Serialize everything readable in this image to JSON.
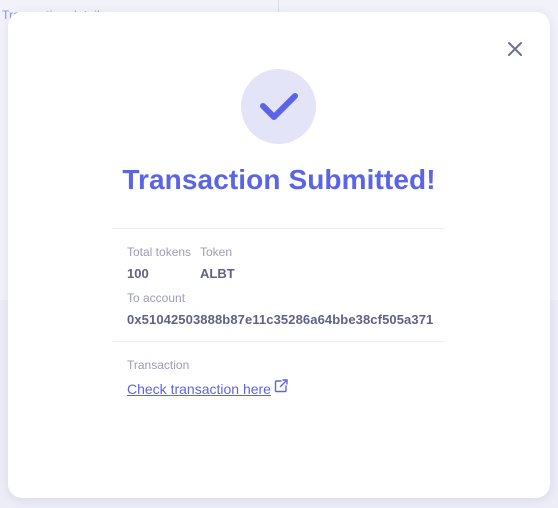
{
  "background": {
    "text": "Transaction details"
  },
  "modal": {
    "title": "Transaction Submitted!",
    "close_icon": "close-icon",
    "status_icon": "checkmark-icon",
    "details": {
      "total_tokens_label": "Total tokens",
      "total_tokens_value": "100",
      "token_label": "Token",
      "token_value": "ALBT",
      "to_account_label": "To account",
      "to_account_value": "0x51042503888b87e11c35286a64bbe38cf505a371"
    },
    "transaction": {
      "label": "Transaction",
      "link_text": "Check transaction here",
      "link_icon": "external-link-icon"
    }
  },
  "colors": {
    "accent": "#5b64e6",
    "check_circle_bg": "#e3e4f8",
    "label": "#9a9cb8",
    "value": "#5f6187"
  }
}
